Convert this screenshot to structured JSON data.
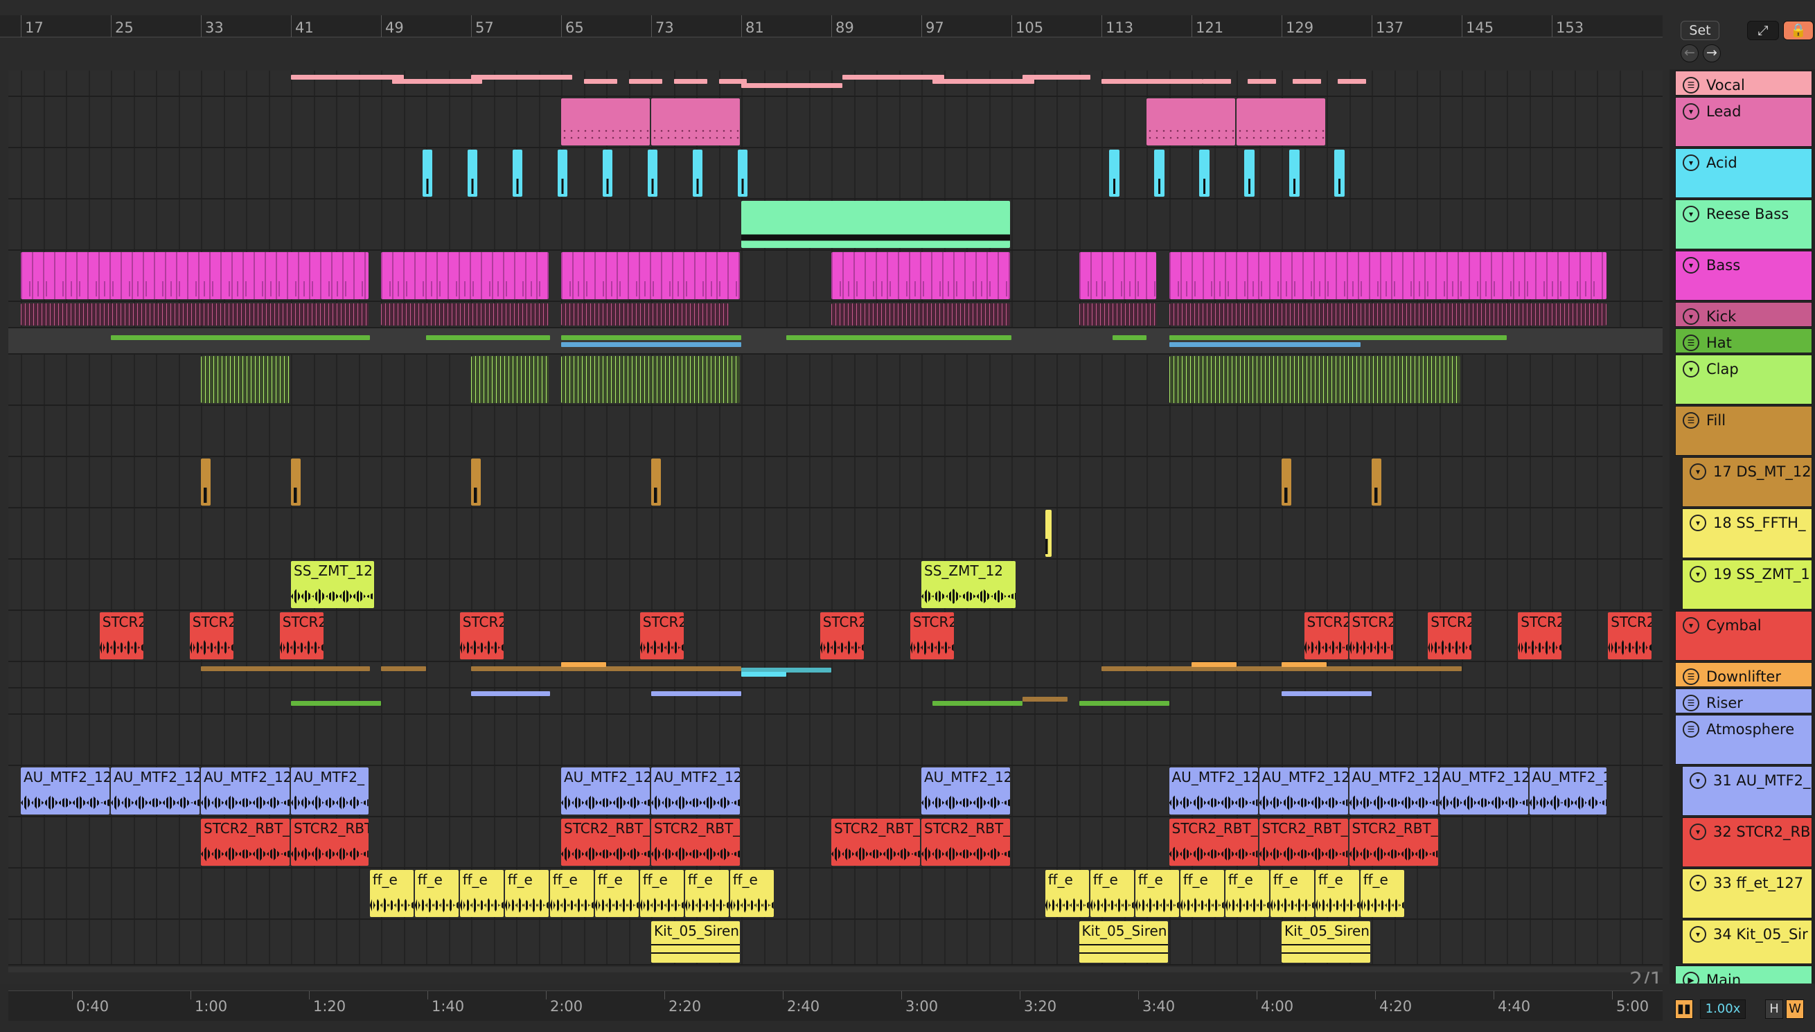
{
  "ruler": {
    "bars": [
      "17",
      "25",
      "33",
      "41",
      "49",
      "57",
      "65",
      "73",
      "81",
      "89",
      "97",
      "105",
      "113",
      "121",
      "129",
      "137",
      "145",
      "153"
    ]
  },
  "topbar": {
    "set_label": "Set"
  },
  "tracks": [
    {
      "name": "Vocal",
      "color": "#f7a4ae",
      "type": "group"
    },
    {
      "name": "Lead",
      "color": "#e36fac",
      "type": "fold"
    },
    {
      "name": "Acid",
      "color": "#5fe0f4",
      "type": "fold"
    },
    {
      "name": "Reese Bass",
      "color": "#7ef2b0",
      "type": "fold"
    },
    {
      "name": "Bass",
      "color": "#ec4fd0",
      "type": "fold"
    },
    {
      "name": "Kick",
      "color": "#c75a8d",
      "type": "fold"
    },
    {
      "name": "Hat",
      "color": "#63b73c",
      "type": "group"
    },
    {
      "name": "Clap",
      "color": "#aef06a",
      "type": "fold"
    },
    {
      "name": "Fill",
      "color": "#c48e3a",
      "type": "group"
    },
    {
      "name": "17 DS_MT_12",
      "color": "#c48e3a",
      "type": "fold"
    },
    {
      "name": "18 SS_FFTH_",
      "color": "#f4ea6a",
      "type": "fold"
    },
    {
      "name": "19 SS_ZMT_1",
      "color": "#d4f05a",
      "type": "fold"
    },
    {
      "name": "Cymbal",
      "color": "#e84a45",
      "type": "fold"
    },
    {
      "name": "Downlifter",
      "color": "#f6ab4d",
      "type": "group"
    },
    {
      "name": "Riser",
      "color": "#9aa8f4",
      "type": "group"
    },
    {
      "name": "Atmosphere",
      "color": "#9aa8f4",
      "type": "group"
    },
    {
      "name": "31 AU_MTF2_",
      "color": "#9aa8f4",
      "type": "fold"
    },
    {
      "name": "32 STCR2_RB",
      "color": "#e84a45",
      "type": "fold"
    },
    {
      "name": "33 ff_et_127",
      "color": "#f4ea6a",
      "type": "fold"
    },
    {
      "name": "34 Kit_05_Sir",
      "color": "#f4ea6a",
      "type": "fold"
    },
    {
      "name": "Main",
      "color": "#7ef2b0",
      "type": "play"
    }
  ],
  "clips": {
    "ss_zmt": "SS_ZMT_12",
    "stcr2": "STCR2",
    "au_mtf2": "AU_MTF2_12",
    "au_mtf2_short": "AU_MTF2_",
    "stcr2_rbt": "STCR2_RBT_",
    "ff_e": "ff_e",
    "kit": "Kit_05_Siren"
  },
  "timeline": {
    "labels": [
      "0:40",
      "1:00",
      "1:20",
      "1:40",
      "2:00",
      "2:20",
      "2:40",
      "3:00",
      "3:20",
      "3:40",
      "4:00",
      "4:20",
      "4:40",
      "5:00"
    ]
  },
  "zoom_label": "2/1",
  "status": {
    "tempo_zoom": "1.00x",
    "h_label": "H",
    "w_label": "W"
  }
}
